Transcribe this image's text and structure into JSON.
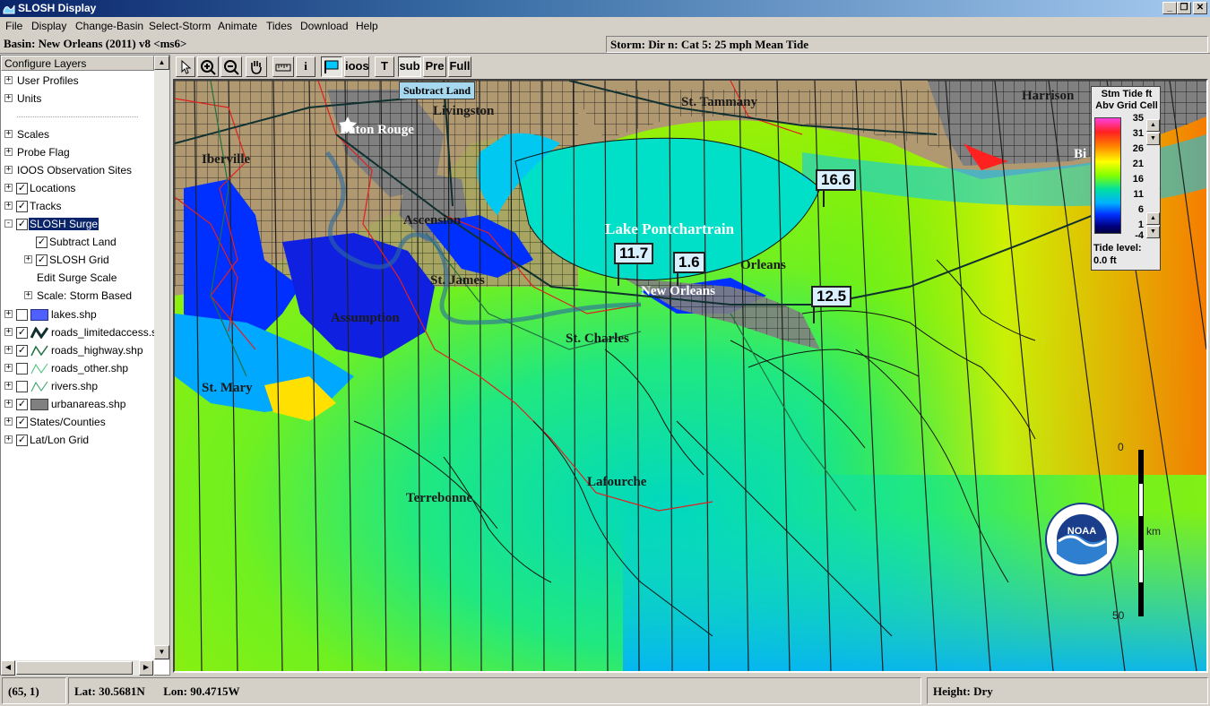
{
  "window": {
    "title": "SLOSH Display",
    "minimize": "_",
    "restore": "❐",
    "close": "✕"
  },
  "menu": [
    "File",
    "Display",
    "Change-Basin",
    "Select-Storm",
    "Animate",
    "Tides",
    "Download",
    "Help"
  ],
  "info": {
    "basin": "Basin: New Orleans (2011) v8 <ms6>",
    "storm": "Storm: Dir n: Cat 5: 25 mph Mean Tide"
  },
  "layers": {
    "header": "Configure Layers",
    "items": [
      {
        "label": "User Profiles",
        "expander": "+",
        "checked": null
      },
      {
        "label": "Units",
        "expander": "+",
        "checked": null
      },
      {
        "label": "Scales",
        "expander": "+",
        "checked": null
      },
      {
        "label": "Probe Flag",
        "expander": "+",
        "checked": null
      },
      {
        "label": "IOOS Observation Sites",
        "expander": "+",
        "checked": null
      },
      {
        "label": "Locations",
        "expander": "+",
        "checked": true
      },
      {
        "label": "Tracks",
        "expander": "+",
        "checked": true
      },
      {
        "label": "SLOSH Surge",
        "expander": "-",
        "checked": true
      },
      {
        "label": "Subtract Land",
        "expander": null,
        "checked": true
      },
      {
        "label": "SLOSH Grid",
        "expander": "+",
        "checked": true
      },
      {
        "label": "Edit Surge Scale",
        "expander": null,
        "checked": null
      },
      {
        "label": "Scale: Storm Based",
        "expander": "+",
        "checked": null
      },
      {
        "label": "lakes.shp",
        "expander": "+",
        "checked": false
      },
      {
        "label": "roads_limitedaccess.sh",
        "expander": "+",
        "checked": true
      },
      {
        "label": "roads_highway.shp",
        "expander": "+",
        "checked": true
      },
      {
        "label": "roads_other.shp",
        "expander": "+",
        "checked": false
      },
      {
        "label": "rivers.shp",
        "expander": "+",
        "checked": false
      },
      {
        "label": "urbanareas.shp",
        "expander": "+",
        "checked": true
      },
      {
        "label": "States/Counties",
        "expander": "+",
        "checked": true
      },
      {
        "label": "Lat/Lon Grid",
        "expander": "+",
        "checked": true
      }
    ],
    "check_mark": "✓"
  },
  "toolbar": {
    "iops_label": "ioos",
    "text_label": "T",
    "sub_label": "sub",
    "pre_label": "Pre",
    "full_label": "Full",
    "info_label": "i",
    "tooltip": "Subtract Land"
  },
  "map": {
    "places": {
      "baton_rouge": "Baton Rouge",
      "iberville": "Iberville",
      "livingston": "Livingston",
      "st_tammany": "St. Tammany",
      "harrison": "Harrison",
      "ascension": "Ascension",
      "lake_pontchartrain": "Lake Pontchartrain",
      "st_james": "St. James",
      "orleans": "Orleans",
      "new_orleans": "New Orleans",
      "assumption": "Assumption",
      "st_charles": "St. Charles",
      "st_mary": "St. Mary",
      "terrebonne": "Terrebonne",
      "lafourche": "Lafourche",
      "bi": "Bi"
    },
    "probes": {
      "p1": "16.6",
      "p2": "11.7",
      "p3": "1.6",
      "p4": "12.5"
    },
    "colors": {
      "land": "#b09870",
      "urban": "#808080",
      "grid_line": "#202020",
      "county_line": "#e02020",
      "water_low": "#00b0ff",
      "water_mid": "#00e8c0",
      "green": "#60f000",
      "surge_high": "#0020ff"
    }
  },
  "legend": {
    "title_line1": "Stm Tide ft",
    "title_line2": "Abv Grid Cell",
    "ticks": [
      "35",
      "31",
      "26",
      "21",
      "16",
      "11",
      "6",
      "1",
      "-4"
    ],
    "tide_label": "Tide level:",
    "tide_value": "0.0 ft"
  },
  "scale_bar": {
    "top": "0",
    "bottom": "50",
    "unit": "km"
  },
  "noaa": {
    "label": "NOAA"
  },
  "status": {
    "cell": "(65, 1)",
    "lat": "Lat:  30.5681N",
    "lon": "Lon:  90.4715W",
    "height": "Height:  Dry"
  }
}
